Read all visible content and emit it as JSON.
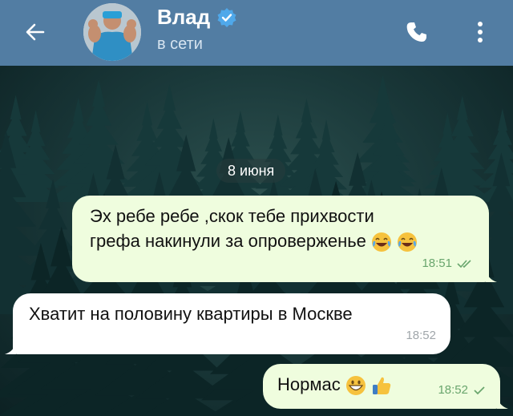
{
  "header": {
    "contact_name": "Влад",
    "status": "в сети",
    "colors": {
      "bar": "#527da3",
      "verified": "#4fa8ea"
    },
    "icons": {
      "back": "arrow-left-icon",
      "call": "phone-icon",
      "menu": "more-vertical-icon",
      "verified": "verified-badge-icon"
    }
  },
  "chat": {
    "date_label": "8 июня",
    "messages": [
      {
        "direction": "outgoing",
        "lines": [
          "Эх ребе ребе ,скок тебе прихвости",
          "грефа накинули за опроверженье"
        ],
        "emojis": [
          "face-with-tears-of-joy",
          "face-with-tears-of-joy"
        ],
        "time": "18:51",
        "read": true
      },
      {
        "direction": "incoming",
        "text": "Хватит на половину квартиры в Москве",
        "time": "18:52"
      },
      {
        "direction": "outgoing",
        "text": "Нормас",
        "emojis": [
          "grinning-face",
          "thumbs-up"
        ],
        "time": "18:52",
        "read": false
      }
    ],
    "colors": {
      "outgoing_bubble": "#effdde",
      "incoming_bubble": "#ffffff",
      "check": "#6aa66e"
    }
  }
}
